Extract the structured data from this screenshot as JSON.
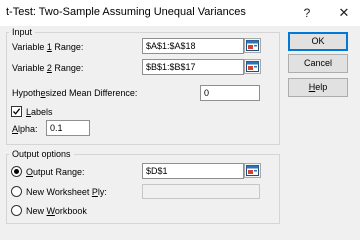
{
  "dialog": {
    "title": "t-Test: Two-Sample Assuming Unequal Variances",
    "help_glyph": "?",
    "close_glyph": "✕"
  },
  "input_group": {
    "label": "Input",
    "variable1": {
      "label_pre": "Variable ",
      "label_key": "1",
      "label_post": " Range:",
      "value": "$A$1:$A$18"
    },
    "variable2": {
      "label_pre": "Variable ",
      "label_key": "2",
      "label_post": " Range:",
      "value": "$B$1:$B$17"
    },
    "hypothesized": {
      "label_pre": "Hypoth",
      "label_key": "e",
      "label_post": "sized Mean Difference:",
      "value": "0"
    },
    "labels": {
      "label_key": "L",
      "label_post": "abels",
      "checked": true
    },
    "alpha": {
      "label_key": "A",
      "label_post": "lpha:",
      "value": "0.1"
    }
  },
  "output_group": {
    "label": "Output options",
    "output_range": {
      "label_key": "O",
      "label_post": "utput Range:",
      "value": "$D$1",
      "selected": true
    },
    "new_worksheet": {
      "label_pre": "New Worksheet ",
      "label_key": "P",
      "label_post": "ly:",
      "value": "",
      "selected": false
    },
    "new_workbook": {
      "label_pre": "New ",
      "label_key": "W",
      "label_post": "orkbook",
      "selected": false
    }
  },
  "buttons": {
    "ok": "OK",
    "cancel": "Cancel",
    "help_key": "H",
    "help_post": "elp"
  },
  "icons": {
    "collapse": "range-selector-icon",
    "checkmark": "checkmark-icon",
    "accent": "#0078d7"
  }
}
